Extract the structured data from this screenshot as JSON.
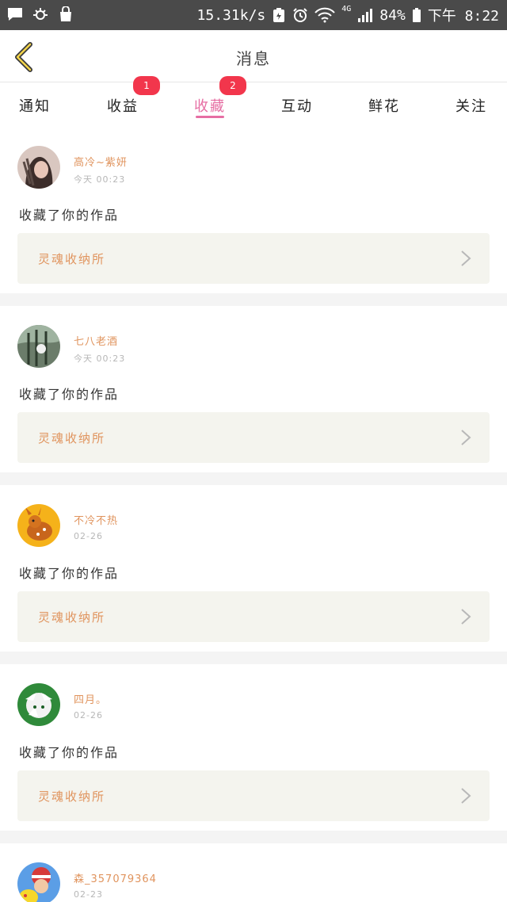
{
  "status_bar": {
    "speed": "15.31k/s",
    "network": "4G",
    "battery": "84%",
    "time": "下午 8:22",
    "icons": [
      "message-icon",
      "eye-icon",
      "bag-icon",
      "battery-saver-icon",
      "alarm-icon",
      "wifi-icon",
      "signal-icon",
      "battery-icon"
    ]
  },
  "header": {
    "title": "消息",
    "back_icon": "chevron-left-icon"
  },
  "tabs": [
    {
      "label": "通知",
      "badge": ""
    },
    {
      "label": "收益",
      "badge": "1"
    },
    {
      "label": "收藏",
      "badge": "2",
      "active": true
    },
    {
      "label": "互动",
      "badge": ""
    },
    {
      "label": "鲜花",
      "badge": ""
    },
    {
      "label": "关注",
      "badge": ""
    }
  ],
  "messages": [
    {
      "user": "高冷~紫妍",
      "time": "今天 00:23",
      "action": "收藏了你的作品",
      "work": "灵魂收纳所"
    },
    {
      "user": "七八老酒",
      "time": "今天 00:23",
      "action": "收藏了你的作品",
      "work": "灵魂收纳所"
    },
    {
      "user": "不冷不热",
      "time": "02-26",
      "action": "收藏了你的作品",
      "work": "灵魂收纳所"
    },
    {
      "user": "四月。",
      "time": "02-26",
      "action": "收藏了你的作品",
      "work": "灵魂收纳所"
    },
    {
      "user": "森_357079364",
      "time": "02-23",
      "action": "",
      "work": ""
    }
  ],
  "colors": {
    "accent": "#e66ea3",
    "badge": "#f2364c",
    "username": "#e0945e",
    "status_bar_bg": "#4a4a4a",
    "card_work_bg": "#f4f4ee"
  }
}
